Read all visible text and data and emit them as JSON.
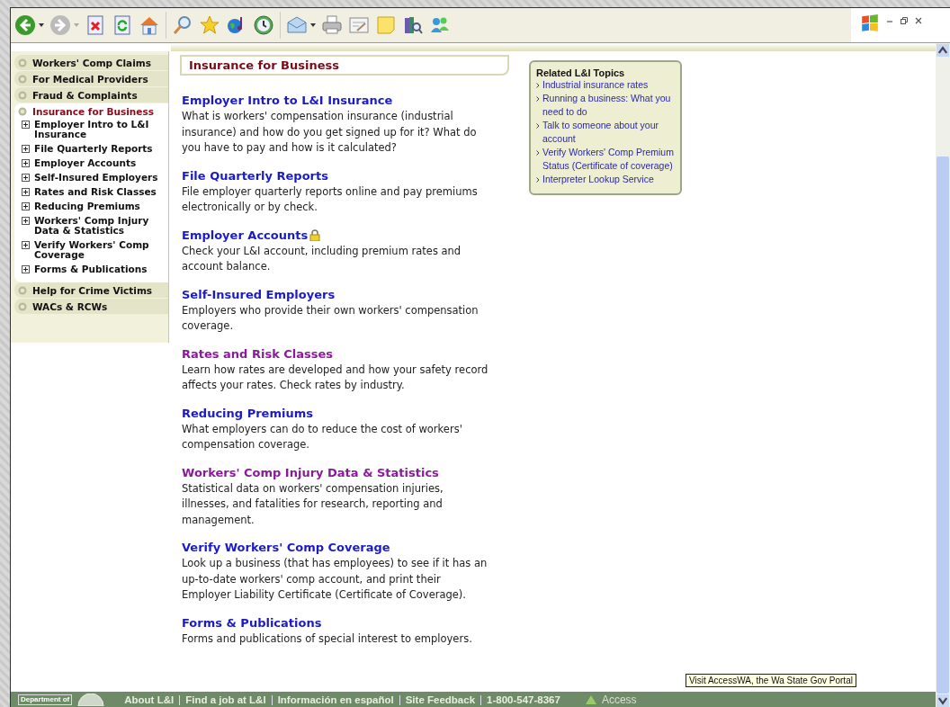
{
  "sidebar": {
    "items": [
      {
        "label": "Workers' Comp Claims",
        "selected": false
      },
      {
        "label": "For Medical Providers",
        "selected": false
      },
      {
        "label": "Fraud & Complaints",
        "selected": false
      },
      {
        "label": "Insurance for Business",
        "selected": true,
        "children": [
          {
            "label": "Employer Intro to L&I Insurance"
          },
          {
            "label": "File Quarterly Reports"
          },
          {
            "label": "Employer Accounts"
          },
          {
            "label": "Self-Insured Employers"
          },
          {
            "label": "Rates and Risk Classes"
          },
          {
            "label": "Reducing Premiums"
          },
          {
            "label": "Workers' Comp Injury Data & Statistics"
          },
          {
            "label": "Verify Workers' Comp Coverage"
          },
          {
            "label": "Forms & Publications"
          }
        ]
      },
      {
        "label": "Help for Crime Victims",
        "selected": false
      },
      {
        "label": "WACs & RCWs",
        "selected": false
      }
    ]
  },
  "page_title": "Insurance for Business",
  "sections": [
    {
      "title": "Employer Intro to L&I Insurance",
      "visited": false,
      "locked": false,
      "text": "What is workers' compensation insurance (industrial insurance) and how do you get signed up for it? What do you have to pay and how is it calculated?"
    },
    {
      "title": "File Quarterly Reports",
      "visited": false,
      "locked": false,
      "text": "File employer quarterly reports online and pay premiums electronically or by check."
    },
    {
      "title": "Employer Accounts",
      "visited": false,
      "locked": true,
      "text": "Check your L&I account, including premium rates and account balance."
    },
    {
      "title": "Self-Insured Employers",
      "visited": false,
      "locked": false,
      "text": "Employers who provide their own workers' compensation coverage."
    },
    {
      "title": "Rates and Risk Classes",
      "visited": true,
      "locked": false,
      "text": "Learn how rates are developed and how your safety record affects your rates. Check rates by industry."
    },
    {
      "title": "Reducing Premiums",
      "visited": false,
      "locked": false,
      "text": "What employers can do to reduce the cost of workers' compensation coverage."
    },
    {
      "title": "Workers' Comp Injury Data & Statistics",
      "visited": true,
      "locked": false,
      "text": "Statistical data on workers' compensation injuries, illnesses, and fatalities for research, reporting and management."
    },
    {
      "title": "Verify Workers' Comp Coverage",
      "visited": false,
      "locked": false,
      "text": "Look up a business (that has employees) to see if it has an up-to-date workers' comp account, and print their Employer Liability Certificate (Certificate of Coverage)."
    },
    {
      "title": "Forms & Publications",
      "visited": false,
      "locked": false,
      "text": "Forms and publications of special interest to employers."
    }
  ],
  "related": {
    "title": "Related L&I Topics",
    "links": [
      "Industrial insurance rates",
      "Running a business: What you need to do",
      "Talk to someone about your account",
      "Verify Workers' Comp Premium Status (Certificate of coverage)",
      "Interpreter Lookup Service"
    ]
  },
  "footer": {
    "logo_text": "Department of",
    "links": [
      "About L&I",
      "Find a job at L&I",
      "Información en español",
      "Site Feedback",
      "1-800-547-8367"
    ],
    "access": "Access"
  },
  "tooltip": "Visit AccessWA, the Wa State Gov Portal"
}
